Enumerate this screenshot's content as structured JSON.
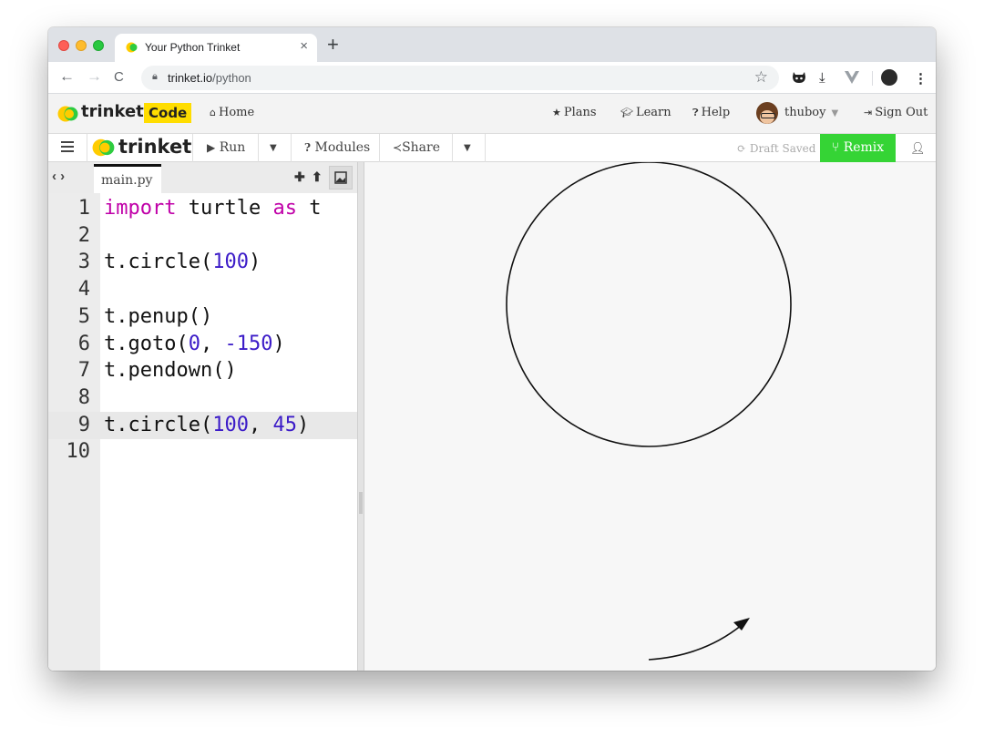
{
  "browser": {
    "tab_title": "Your Python Trinket",
    "tab_close": "×",
    "new_tab": "+",
    "url_host": "trinket.io",
    "url_path": "/python",
    "back": "←",
    "forward": "→",
    "reload": "C"
  },
  "header": {
    "logo_text": "trinket",
    "badge": "Code",
    "home": "Home",
    "plans": "Plans",
    "learn": "Learn",
    "help": "Help",
    "username": "thuboy",
    "sign_out": "Sign Out"
  },
  "toolbar": {
    "logo_text": "trinket",
    "run": "Run",
    "modules": "Modules",
    "share": "Share",
    "draft_status": "Draft Saved",
    "remix": "Remix"
  },
  "editor": {
    "file_name": "main.py",
    "active_line": 9,
    "lines": [
      {
        "n": "1",
        "tokens": [
          {
            "t": "import",
            "c": "kw"
          },
          {
            "t": " turtle ",
            "c": ""
          },
          {
            "t": "as",
            "c": "kw"
          },
          {
            "t": " t",
            "c": ""
          }
        ]
      },
      {
        "n": "2",
        "tokens": []
      },
      {
        "n": "3",
        "tokens": [
          {
            "t": "t.circle(",
            "c": ""
          },
          {
            "t": "100",
            "c": "num"
          },
          {
            "t": ")",
            "c": ""
          }
        ]
      },
      {
        "n": "4",
        "tokens": []
      },
      {
        "n": "5",
        "tokens": [
          {
            "t": "t.penup()",
            "c": ""
          }
        ]
      },
      {
        "n": "6",
        "tokens": [
          {
            "t": "t.goto(",
            "c": ""
          },
          {
            "t": "0",
            "c": "num"
          },
          {
            "t": ", ",
            "c": ""
          },
          {
            "t": "-150",
            "c": "num"
          },
          {
            "t": ")",
            "c": ""
          }
        ]
      },
      {
        "n": "7",
        "tokens": [
          {
            "t": "t.pendown()",
            "c": ""
          }
        ]
      },
      {
        "n": "8",
        "tokens": []
      },
      {
        "n": "9",
        "tokens": [
          {
            "t": "t.circle(",
            "c": ""
          },
          {
            "t": "100",
            "c": "num"
          },
          {
            "t": ", ",
            "c": ""
          },
          {
            "t": "45",
            "c": "num"
          },
          {
            "t": ")",
            "c": ""
          }
        ]
      },
      {
        "n": "10",
        "tokens": []
      }
    ]
  },
  "colors": {
    "keyword": "#c000a8",
    "number": "#3c1cc8",
    "remix": "#35d435",
    "badge": "#ffdd00"
  },
  "icons": {
    "lock": "lock-icon",
    "star": "star-icon",
    "home": "home-icon",
    "plans": "star-icon",
    "learn": "graduation-cap-icon",
    "help": "question-circle-icon",
    "sign_out": "sign-out-icon",
    "run": "play-icon",
    "share": "share-icon",
    "remix": "fork-icon"
  }
}
